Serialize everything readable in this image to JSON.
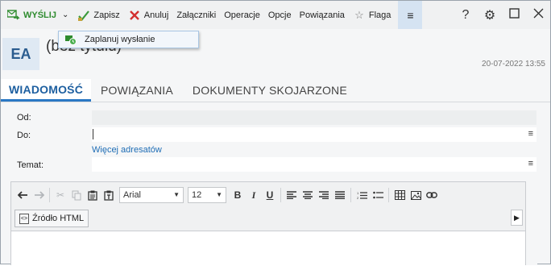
{
  "toolbar": {
    "send_label": "WYŚLIJ",
    "save_label": "Zapisz",
    "cancel_label": "Anuluj",
    "attachments_label": "Załączniki",
    "operations_label": "Operacje",
    "options_label": "Opcje",
    "relations_label": "Powiązania",
    "flag_label": "Flaga",
    "menu_glyph": "≡",
    "help_glyph": "?",
    "settings_glyph": "⚙",
    "maximize_glyph": "☐",
    "close_glyph": "✕"
  },
  "dropdown": {
    "schedule_label": "Zaplanuj wysłanie"
  },
  "header": {
    "avatar_initials": "EA",
    "subject": "(bez tytułu)",
    "date": "20-07-2022 13:55"
  },
  "tabs": [
    {
      "label": "WIADOMOŚĆ",
      "active": true
    },
    {
      "label": "POWIĄZANIA",
      "active": false
    },
    {
      "label": "DOKUMENTY SKOJARZONE",
      "active": false
    }
  ],
  "form": {
    "from_label": "Od:",
    "to_label": "Do:",
    "more_recipients": "Więcej adresatów",
    "subject_label": "Temat:",
    "menu_glyph": "≡"
  },
  "editor": {
    "font_name": "Arial",
    "font_size": "12",
    "bold": "B",
    "italic": "I",
    "underline": "U",
    "html_source_label": "Źródło HTML",
    "more_glyph": "▶"
  },
  "colors": {
    "accent": "#1d5fa0",
    "send_green": "#2e8b2e",
    "link": "#1e6db5",
    "cancel_red": "#d32f2f"
  }
}
